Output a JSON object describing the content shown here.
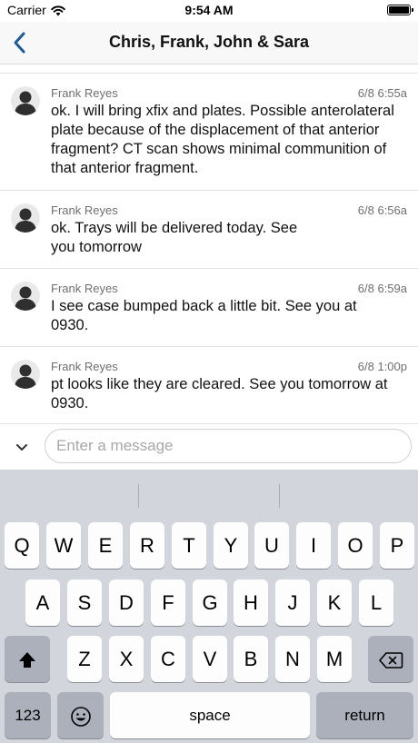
{
  "status": {
    "carrier": "Carrier",
    "time": "9:54 AM"
  },
  "nav": {
    "title": "Chris, Frank, John & Sara"
  },
  "messages": [
    {
      "sender": "Frank Reyes",
      "time": "6/8 6:55a",
      "text": "ok. I will bring xfix and plates.  Possible anterolateral plate because of the displacement of that anterior fragment? CT scan shows minimal communition of that anterior fragment."
    },
    {
      "sender": "Frank Reyes",
      "time": "6/8 6:56a",
      "text": "ok. Trays will be delivered today. See you tomorrow"
    },
    {
      "sender": "Frank Reyes",
      "time": "6/8 6:59a",
      "text": "I see case bumped back a little bit. See you at 0930."
    },
    {
      "sender": "Frank Reyes",
      "time": "6/8 1:00p",
      "text": "pt looks like they are cleared. See you tomorrow at 0930."
    }
  ],
  "composer": {
    "placeholder": "Enter a message"
  },
  "keyboard": {
    "row1": [
      "Q",
      "W",
      "E",
      "R",
      "T",
      "Y",
      "U",
      "I",
      "O",
      "P"
    ],
    "row2": [
      "A",
      "S",
      "D",
      "F",
      "G",
      "H",
      "J",
      "K",
      "L"
    ],
    "row3": [
      "Z",
      "X",
      "C",
      "V",
      "B",
      "N",
      "M"
    ],
    "numbers_label": "123",
    "space_label": "space",
    "return_label": "return"
  },
  "icons": [
    "wifi-icon",
    "battery-icon",
    "back-chevron-icon",
    "avatar-icon",
    "collapse-chevron-icon",
    "shift-icon",
    "delete-icon",
    "emoji-icon"
  ]
}
